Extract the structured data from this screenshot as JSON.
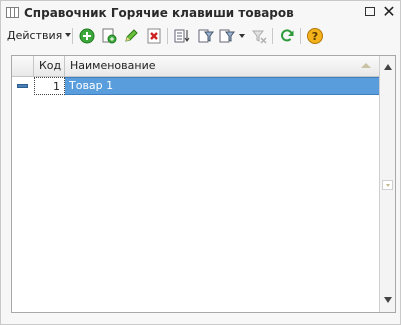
{
  "window": {
    "title": "Справочник Горячие клавиши товаров"
  },
  "toolbar": {
    "actions_label": "Действия",
    "buttons": [
      {
        "icon": "add-icon"
      },
      {
        "icon": "copy-icon"
      },
      {
        "icon": "edit-icon"
      },
      {
        "icon": "delete-icon"
      },
      {
        "icon": "sort-icon"
      },
      {
        "icon": "filter-icon"
      },
      {
        "icon": "filter-menu-icon"
      },
      {
        "icon": "clear-filter-icon"
      },
      {
        "icon": "refresh-icon"
      },
      {
        "icon": "help-icon"
      }
    ]
  },
  "table": {
    "columns": [
      "Код",
      "Наименование"
    ],
    "rows": [
      {
        "code": "1",
        "name": "Товар 1",
        "selected": true
      }
    ]
  },
  "colors": {
    "selection": "#5a9ddc",
    "add": "#3ca83c",
    "delete": "#cc2222",
    "help": "#e8a000"
  }
}
